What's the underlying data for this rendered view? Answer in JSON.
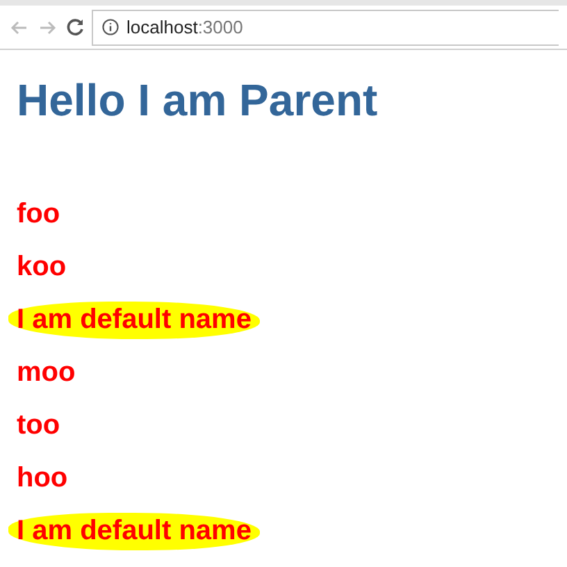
{
  "browser": {
    "address_host": "localhost",
    "address_port": ":3000"
  },
  "heading": "Hello I am Parent",
  "items": [
    {
      "text": "foo",
      "highlighted": false
    },
    {
      "text": "koo",
      "highlighted": false
    },
    {
      "text": "I am default name",
      "highlighted": true
    },
    {
      "text": "moo",
      "highlighted": false
    },
    {
      "text": "too",
      "highlighted": false
    },
    {
      "text": "hoo",
      "highlighted": false
    },
    {
      "text": "I am default name",
      "highlighted": true
    }
  ]
}
